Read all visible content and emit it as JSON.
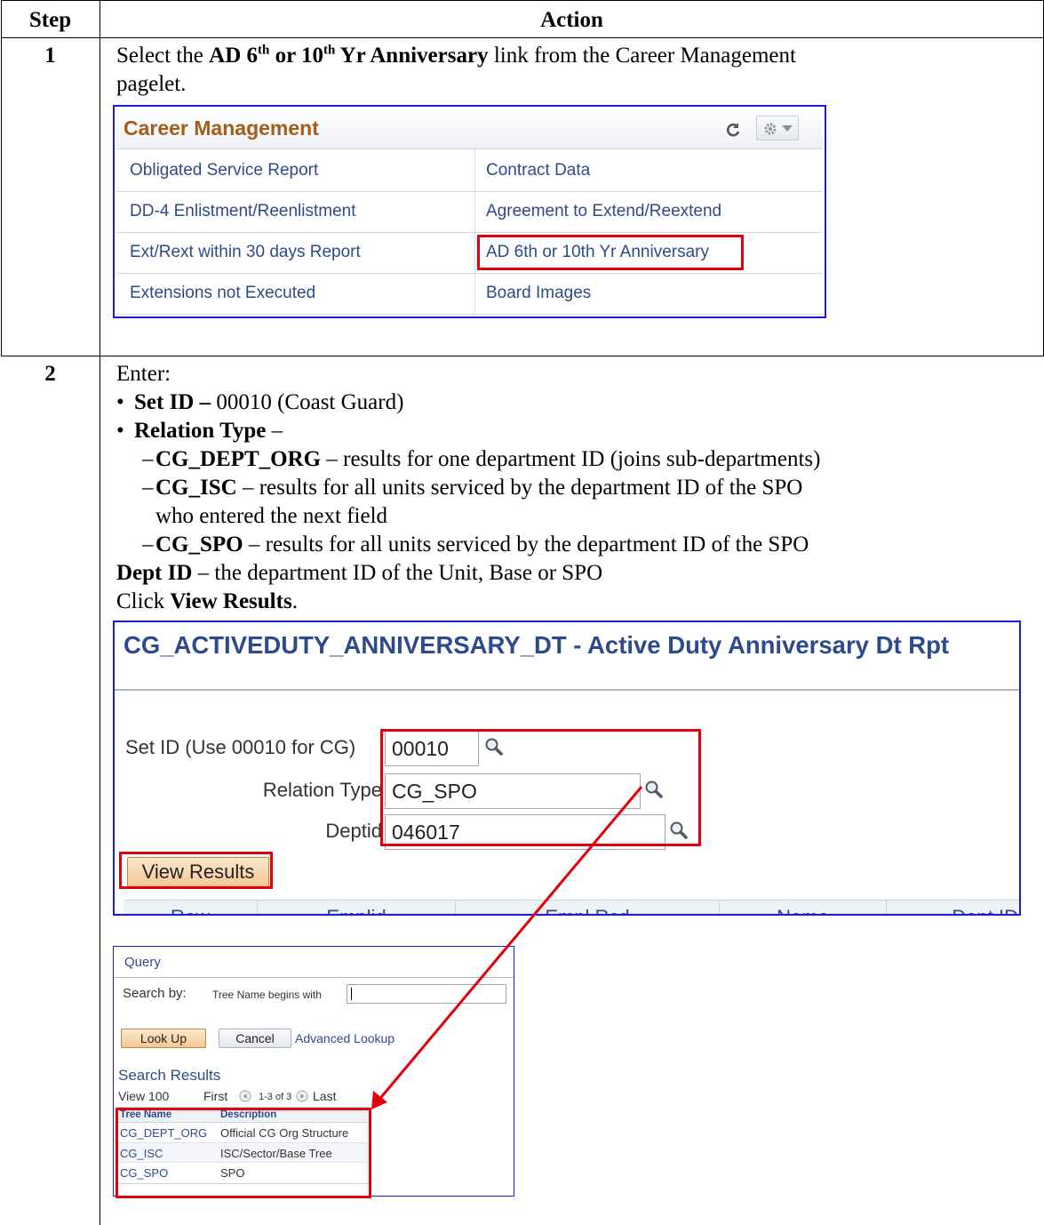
{
  "table": {
    "header_step": "Step",
    "header_action": "Action"
  },
  "step1": {
    "number": "1",
    "text_prefix": "Select the ",
    "bold_link_a": "AD 6",
    "sup_th_a": "th",
    "bold_link_b": " or 10",
    "sup_th_b": "th",
    "bold_link_c": " Yr Anniversary",
    "text_suffix": " link from the Career Management",
    "text_line2": "pagelet."
  },
  "career_pagelet": {
    "title": "Career Management",
    "refresh_icon": "refresh-icon",
    "settings_icon": "gear-icon",
    "links_left": [
      "Obligated Service Report",
      "DD-4 Enlistment/Reenlistment",
      "Ext/Rext within 30 days Report",
      "Extensions not Executed"
    ],
    "links_right": [
      "Contract Data",
      "Agreement to Extend/Reextend",
      "AD 6th or 10th Yr Anniversary",
      "Board Images"
    ]
  },
  "step2": {
    "number": "2",
    "enter": "Enter:",
    "bullet1_bold": "Set ID –",
    "bullet1_text": " 00010 (Coast Guard)",
    "bullet2_bold": "Relation Type",
    "bullet2_text": " –",
    "sub1_bold": "CG_DEPT_ORG",
    "sub1_text": " – results for one department ID (joins sub-departments)",
    "sub2_bold": "CG_ISC",
    "sub2_text": " – results for all units serviced by the department ID of the SPO",
    "sub2_text_line2": "who entered the next field",
    "sub3_bold": "CG_SPO",
    "sub3_text": " – results for all units serviced by the department ID of the SPO",
    "dept_bold": "Dept ID",
    "dept_text": " – the department ID of the Unit, Base or SPO",
    "click_text": "Click ",
    "click_bold": "View Results",
    "click_end": "."
  },
  "report_form": {
    "title": "CG_ACTIVEDUTY_ANNIVERSARY_DT - Active Duty Anniversary Dt Rpt",
    "setid_label": "Set ID (Use 00010 for CG)",
    "setid_value": "00010",
    "relation_label": "Relation Type",
    "relation_value": "CG_SPO",
    "deptid_label": "Deptid",
    "deptid_value": "046017",
    "view_results_button": "View Results",
    "grid_headers": [
      "Row",
      "Emplid",
      "Empl Rcd",
      "Name",
      "Dept ID"
    ]
  },
  "lookup_popup": {
    "title": "Query",
    "search_by_label": "Search by:",
    "search_criteria": "Tree Name begins with",
    "search_value": "",
    "lookup_button": "Look Up",
    "cancel_button": "Cancel",
    "advanced_link": "Advanced Lookup",
    "results_title": "Search Results",
    "view_label": "View 100",
    "first_label": "First",
    "range_label": "1-3 of 3",
    "last_label": "Last",
    "col_tree_name": "Tree Name",
    "col_description": "Description",
    "rows": [
      {
        "tree_name": "CG_DEPT_ORG",
        "description": "Official CG Org Structure"
      },
      {
        "tree_name": "CG_ISC",
        "description": "ISC/Sector/Base Tree"
      },
      {
        "tree_name": "CG_SPO",
        "description": "SPO"
      }
    ]
  },
  "colors": {
    "highlight_red": "#e0000a",
    "frame_blue": "#1a1adc",
    "pagelet_title": "#a55c1b",
    "link_blue": "#2d4b8c"
  }
}
